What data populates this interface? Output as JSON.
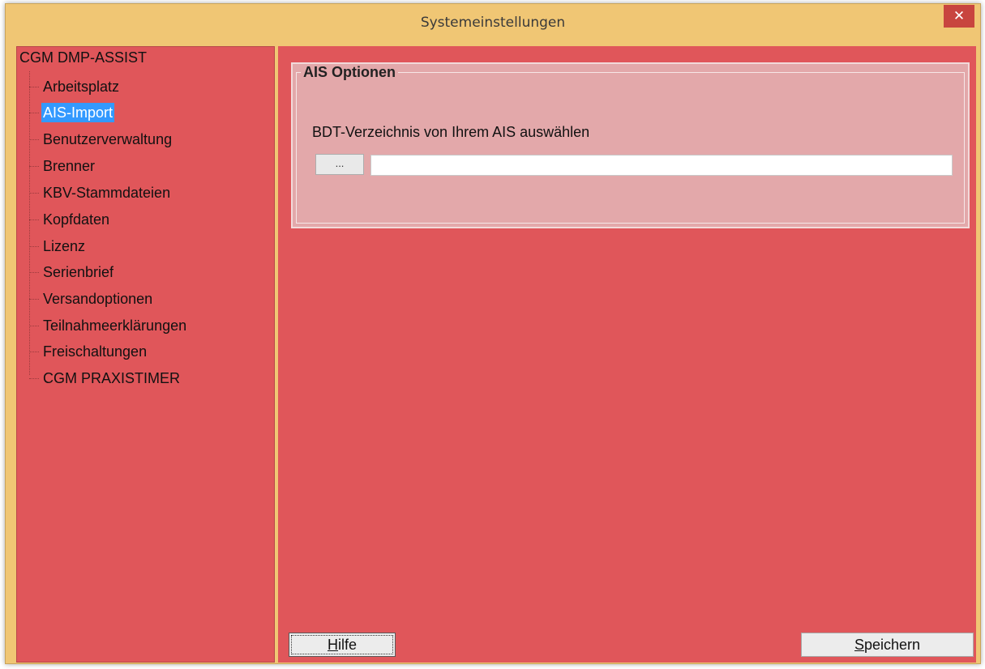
{
  "window": {
    "title": "Systemeinstellungen",
    "close_glyph": "✕"
  },
  "tree": {
    "root": "CGM DMP-ASSIST",
    "items": [
      {
        "label": "Arbeitsplatz"
      },
      {
        "label": "AIS-Import",
        "selected": true
      },
      {
        "label": "Benutzerverwaltung"
      },
      {
        "label": "Brenner"
      },
      {
        "label": "KBV-Stammdateien"
      },
      {
        "label": "Kopfdaten"
      },
      {
        "label": "Lizenz"
      },
      {
        "label": "Serienbrief"
      },
      {
        "label": "Versandoptionen"
      },
      {
        "label": "Teilnahmeerklärungen"
      },
      {
        "label": "Freischaltungen"
      },
      {
        "label": "CGM PRAXISTIMER"
      }
    ]
  },
  "ais_options": {
    "group_title": "AIS Optionen",
    "bdt_label": "BDT-Verzeichnis von Ihrem AIS auswählen",
    "browse_label": "...",
    "path_value": ""
  },
  "buttons": {
    "help_accel": "H",
    "help_rest": "ilfe",
    "save_accel": "S",
    "save_rest": "peichern"
  },
  "colors": {
    "title_bar": "#f0c674",
    "panel_background": "#e0565a",
    "group_background": "#e3a8aa",
    "selection": "#3399ff",
    "close_button": "#c8453f"
  }
}
